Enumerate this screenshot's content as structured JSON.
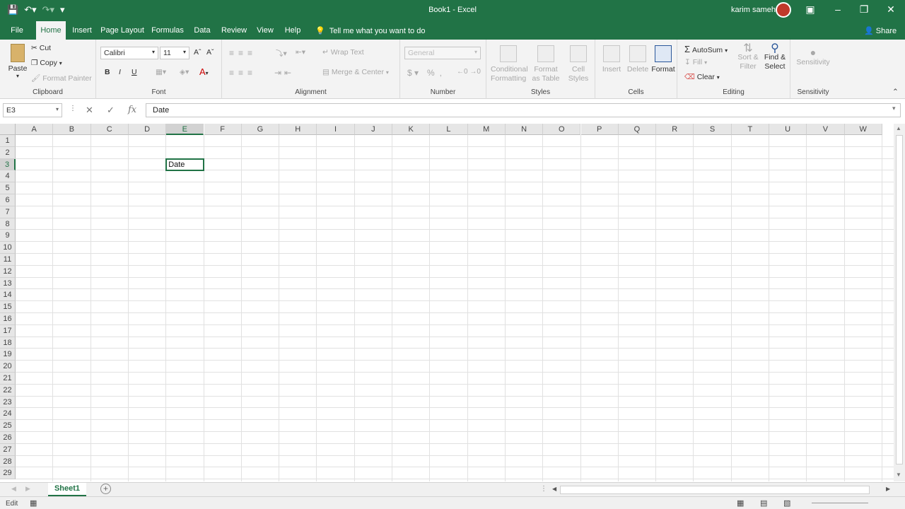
{
  "window": {
    "title": "Book1  -  Excel",
    "user": "karim sameh"
  },
  "tabs": [
    "File",
    "Home",
    "Insert",
    "Page Layout",
    "Formulas",
    "Data",
    "Review",
    "View",
    "Help"
  ],
  "tell_me": "Tell me what you want to do",
  "share": "Share",
  "ribbon": {
    "clipboard": {
      "label": "Clipboard",
      "paste": "Paste",
      "cut": "Cut",
      "copy": "Copy",
      "format_painter": "Format Painter"
    },
    "font": {
      "label": "Font",
      "font_name": "Calibri",
      "font_size": "11",
      "bold": "B",
      "italic": "I",
      "underline": "U"
    },
    "alignment": {
      "label": "Alignment",
      "wrap_text": "Wrap Text",
      "merge_center": "Merge & Center"
    },
    "number": {
      "label": "Number",
      "format": "General"
    },
    "styles": {
      "label": "Styles",
      "conditional_formatting": "Conditional Formatting",
      "format_as_table": "Format as Table",
      "cell_styles": "Cell Styles"
    },
    "cells": {
      "label": "Cells",
      "insert": "Insert",
      "delete": "Delete",
      "format": "Format"
    },
    "editing": {
      "label": "Editing",
      "autosum": "AutoSum",
      "fill": "Fill",
      "clear": "Clear",
      "sort_filter": "Sort & Filter",
      "find_select": "Find & Select"
    },
    "sensitivity": {
      "label": "Sensitivity",
      "button": "Sensitivity"
    }
  },
  "formula_bar": {
    "name_box": "E3",
    "value": "Date"
  },
  "grid": {
    "columns": [
      "A",
      "B",
      "C",
      "D",
      "E",
      "F",
      "G",
      "H",
      "I",
      "J",
      "K",
      "L",
      "M",
      "N",
      "O",
      "P",
      "Q",
      "R",
      "S",
      "T",
      "U",
      "V",
      "W"
    ],
    "rows": [
      "1",
      "2",
      "3",
      "4",
      "5",
      "6",
      "7",
      "8",
      "9",
      "10",
      "11",
      "12",
      "13",
      "14",
      "15",
      "16",
      "17",
      "18",
      "19",
      "20",
      "21",
      "22",
      "23",
      "24",
      "25",
      "26",
      "27",
      "28",
      "29"
    ],
    "active_cell": {
      "ref": "E3",
      "value": "Date"
    }
  },
  "sheets": [
    "Sheet1"
  ],
  "status": {
    "mode": "Edit"
  },
  "colors": {
    "accent": "#217346"
  }
}
